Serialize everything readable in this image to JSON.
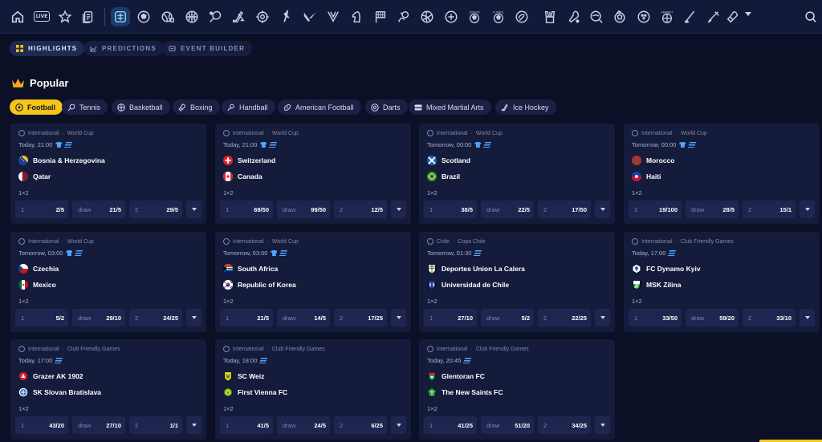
{
  "topbar": {
    "icons": [
      "home-icon",
      "live-icon",
      "star-icon",
      "betslip-icon",
      "highlights-icon",
      "football-icon",
      "hockey-ball-icon",
      "basketball-icon",
      "tennis-icon",
      "hockey-icon",
      "target-icon",
      "cricket-icon",
      "valorant-icon",
      "league-icon",
      "chess-icon",
      "racing-flag-icon",
      "handball-icon",
      "volleyball-icon",
      "efootball-icon",
      "fifa-icon",
      "efootball-cyber-icon",
      "mma-glove-icon",
      "badminton-icon",
      "table-tennis-icon",
      "water-polo-icon",
      "futsal-icon",
      "ebasketball-icon",
      "golf-icon",
      "boxing-icon",
      "search-icon"
    ],
    "live_label": "LIVE",
    "badge_2024": "2024/25",
    "badge_fifa": "FUTBOL",
    "badge_ebasket": "EBASKET"
  },
  "view_tabs": [
    {
      "label": "HIGHLIGHTS",
      "icon": "grid-icon",
      "active": true
    },
    {
      "label": "PREDICTIONS",
      "icon": "predictions-icon",
      "active": false
    },
    {
      "label": "EVENT BUILDER",
      "icon": "builder-icon",
      "active": false
    }
  ],
  "section": {
    "title": "Popular",
    "icon": "crown-icon",
    "icon_color": "#f5a623"
  },
  "sports": [
    {
      "label": "Football",
      "icon": "football-icon",
      "active": true
    },
    {
      "label": "Tennis",
      "icon": "tennis-icon",
      "active": false
    },
    {
      "label": "Basketball",
      "icon": "basketball-icon",
      "active": false
    },
    {
      "label": "Boxing",
      "icon": "boxing-icon",
      "active": false
    },
    {
      "label": "Handball",
      "icon": "handball-icon",
      "active": false
    },
    {
      "label": "American Football",
      "icon": "american-football-icon",
      "active": false
    },
    {
      "label": "Darts",
      "icon": "darts-icon",
      "active": false
    },
    {
      "label": "Mixed Martial Arts",
      "icon": "mma-icon",
      "active": false
    },
    {
      "label": "Ice Hockey",
      "icon": "ice-hockey-icon",
      "active": false
    }
  ],
  "market_label": "1×2",
  "odds_labels": {
    "home": "1",
    "draw": "draw",
    "away": "2"
  },
  "events": [
    {
      "region": "International",
      "league": "World Cup",
      "time": "Today, 21:00",
      "shirt": true,
      "home": "Bosnia & Herzegovina",
      "away": "Qatar",
      "flags": [
        "ba",
        "qa"
      ],
      "odds": [
        "2/5",
        "21/5",
        "29/5"
      ]
    },
    {
      "region": "International",
      "league": "World Cup",
      "time": "Today, 21:00",
      "shirt": true,
      "home": "Switzerland",
      "away": "Canada",
      "flags": [
        "ch",
        "ca"
      ],
      "odds": [
        "69/50",
        "99/50",
        "12/5"
      ]
    },
    {
      "region": "International",
      "league": "World Cup",
      "time": "Tomorrow, 00:00",
      "shirt": true,
      "home": "Scotland",
      "away": "Brazil",
      "flags": [
        "sco",
        "br"
      ],
      "odds": [
        "38/5",
        "22/5",
        "17/50"
      ]
    },
    {
      "region": "International",
      "league": "World Cup",
      "time": "Tomorrow, 00:00",
      "shirt": true,
      "home": "Morocco",
      "away": "Haiti",
      "flags": [
        "ma",
        "ht"
      ],
      "odds": [
        "19/100",
        "28/5",
        "15/1"
      ]
    },
    {
      "region": "International",
      "league": "World Cup",
      "time": "Tomorrow, 03:00",
      "shirt": true,
      "home": "Czechia",
      "away": "Mexico",
      "flags": [
        "cz",
        "mx"
      ],
      "odds": [
        "5/2",
        "29/10",
        "24/25"
      ]
    },
    {
      "region": "International",
      "league": "World Cup",
      "time": "Tomorrow, 03:00",
      "shirt": true,
      "home": "South Africa",
      "away": "Republic of Korea",
      "flags": [
        "za",
        "kr"
      ],
      "odds": [
        "21/5",
        "14/5",
        "17/25"
      ]
    },
    {
      "region": "Chile",
      "league": "Copa Chile",
      "time": "Tomorrow, 01:30",
      "shirt": false,
      "home": "Deportes Union La Calera",
      "away": "Universidad de Chile",
      "flags": [
        "calera",
        "udechile"
      ],
      "odds": [
        "27/10",
        "5/2",
        "22/25"
      ]
    },
    {
      "region": "International",
      "league": "Club Friendly Games",
      "time": "Today, 17:00",
      "shirt": false,
      "home": "FC Dynamo Kyiv",
      "away": "MSK Zilina",
      "flags": [
        "dynamo",
        "zilina"
      ],
      "odds": [
        "33/50",
        "59/20",
        "33/10"
      ]
    },
    {
      "region": "International",
      "league": "Club Friendly Games",
      "time": "Today, 17:00",
      "shirt": false,
      "home": "Grazer AK 1902",
      "away": "SK Slovan Bratislava",
      "flags": [
        "grazer",
        "slovan"
      ],
      "odds": [
        "43/20",
        "27/10",
        "1/1"
      ]
    },
    {
      "region": "International",
      "league": "Club Friendly Games",
      "time": "Today, 18:00",
      "shirt": false,
      "home": "SC Weiz",
      "away": "First Vienna FC",
      "flags": [
        "weiz",
        "vienna"
      ],
      "odds": [
        "41/5",
        "24/5",
        "6/25"
      ]
    },
    {
      "region": "International",
      "league": "Club Friendly Games",
      "time": "Today, 20:45",
      "shirt": false,
      "home": "Glentoran FC",
      "away": "The New Saints FC",
      "flags": [
        "glentoran",
        "tns"
      ],
      "odds": [
        "41/25",
        "51/20",
        "34/25"
      ]
    }
  ]
}
